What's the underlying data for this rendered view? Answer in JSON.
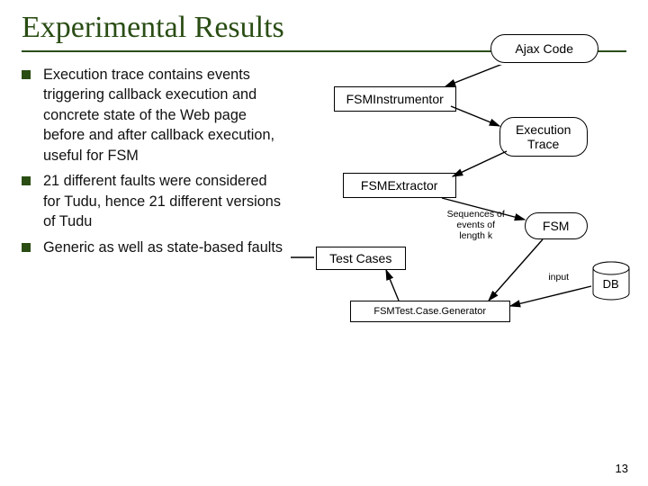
{
  "title": "Experimental Results",
  "bullets": [
    "Execution trace contains events triggering callback execution and concrete state of the Web page before and after callback execution, useful for FSM",
    "21 different faults were considered for Tudu, hence 21 different versions of Tudu",
    "Generic as well as state-based faults"
  ],
  "diagram": {
    "ajax_code": "Ajax Code",
    "fsminstrumentor": "FSMInstrumentor",
    "execution_trace": "Execution\nTrace",
    "fsmextractor": "FSMExtractor",
    "sequences_label": "Sequences of\nevents of\nlength k",
    "fsm": "FSM",
    "test_cases": "Test Cases",
    "fsmtestcasegen": "FSMTest.Case.Generator",
    "input_label": "input",
    "db": "DB"
  },
  "page_number": "13"
}
